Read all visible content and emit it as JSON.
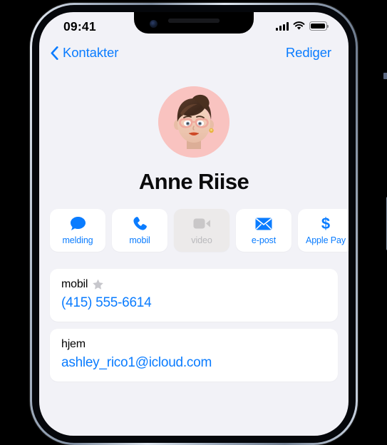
{
  "status_bar": {
    "time": "09:41",
    "cellular_icon": "cellular-bars-icon",
    "wifi_icon": "wifi-icon",
    "battery_icon": "battery-icon"
  },
  "nav_bar": {
    "back_label": "Kontakter",
    "back_icon": "chevron-left-icon",
    "edit_label": "Rediger"
  },
  "contact": {
    "name": "Anne Riise",
    "avatar_icon": "memoji-avatar",
    "avatar_background": "#f9c3c0"
  },
  "actions": [
    {
      "label": "melding",
      "icon": "message-bubble-icon",
      "enabled": true
    },
    {
      "label": "mobil",
      "icon": "phone-handset-icon",
      "enabled": true
    },
    {
      "label": "video",
      "icon": "video-camera-icon",
      "enabled": false
    },
    {
      "label": "e-post",
      "icon": "envelope-icon",
      "enabled": true
    },
    {
      "label": "Apple Pay",
      "icon": "dollar-sign-icon",
      "enabled": true
    }
  ],
  "details": [
    {
      "label": "mobil",
      "value": "(415) 555-6614",
      "favorite": true,
      "favorite_icon": "star-icon"
    },
    {
      "label": "hjem",
      "value": "ashley_rico1@icloud.com",
      "favorite": false
    }
  ],
  "colors": {
    "accent_blue": "#0a7cff",
    "screen_background": "#f2f2f7",
    "card_background": "#ffffff",
    "disabled_gray": "#b9b9bc"
  }
}
